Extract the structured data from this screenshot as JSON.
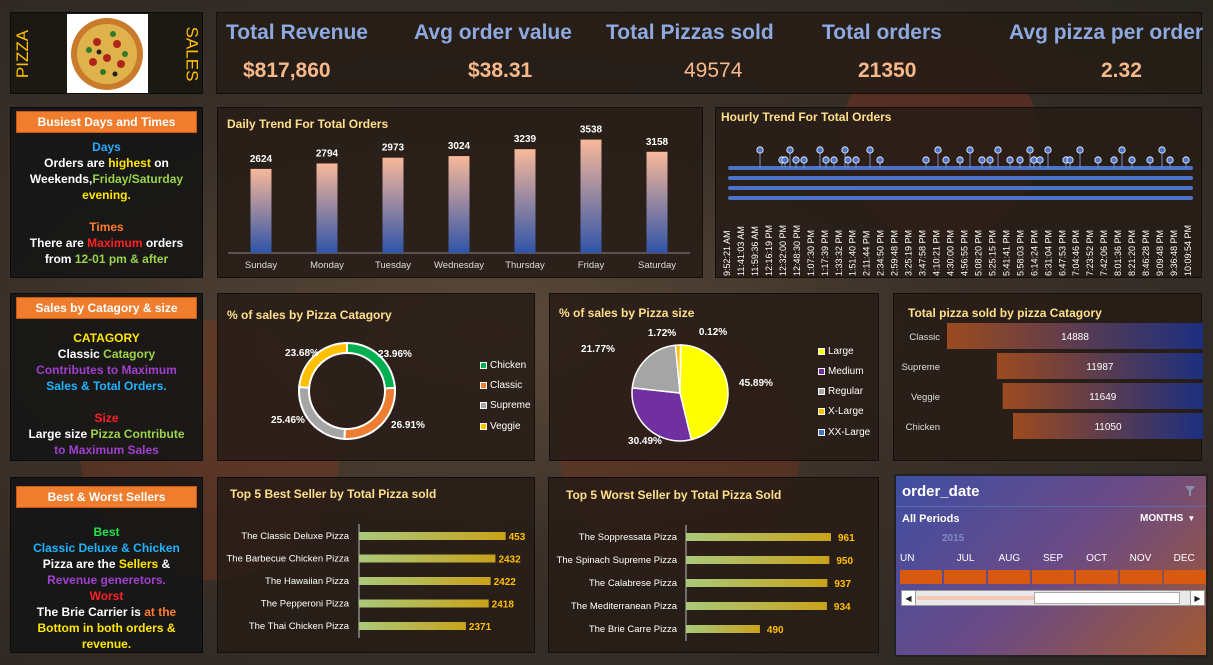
{
  "logo": {
    "left_text": "PIZZA",
    "right_text": "SALES"
  },
  "kpis": [
    {
      "title": "Total Revenue",
      "value": "$817,860"
    },
    {
      "title": "Avg order value",
      "value": "$38.31"
    },
    {
      "title": "Total Pizzas sold",
      "value": "49574"
    },
    {
      "title": "Total orders",
      "value": "21350"
    },
    {
      "title": "Avg pizza per order",
      "value": "2.32"
    }
  ],
  "side": {
    "busiest": {
      "header": "Busiest Days and Times",
      "days_label": "Days",
      "line1_a": "Orders are ",
      "line1_b": "highest",
      "line1_c": " on",
      "line2_a": "Weekends,",
      "line2_b": "Friday/Saturday",
      "line3": "evening.",
      "times_label": "Times",
      "line4_a": "There are ",
      "line4_b": "Maximum",
      "line4_c": " orders",
      "line5_a": "from  ",
      "line5_b": "12-01 pm & after"
    },
    "category": {
      "header": "Sales by Catagory & size",
      "cat_label": "CATAGORY",
      "line1_a": "Classic ",
      "line1_b": "Catagory",
      "line2": "Contributes to Maximum",
      "line3": "Sales & Total Orders.",
      "size_label": "Size",
      "line4_a": "Large size ",
      "line4_b": "Pizza Contribute",
      "line5": "to Maximum Sales"
    },
    "sellers": {
      "header": "Best & Worst  Sellers",
      "best_label": "Best",
      "line1": "Classic Deluxe & Chicken",
      "line2_a": "Pizza are the ",
      "line2_b": "Sellers",
      "line2_c": "  &",
      "line3": "Revenue generetors.",
      "worst_label": "Worst",
      "line4_a": "The Brie Carrier is ",
      "line4_b": "at the",
      "line5": "Bottom in both orders &",
      "line6": "revenue."
    }
  },
  "colors": {
    "chicken": "#00b050",
    "classic": "#ed7d31",
    "supreme": "#a5a5a5",
    "veggie": "#ffc000",
    "large": "#ffff00",
    "medium": "#7030a0",
    "regular": "#a5a5a5",
    "xlarge": "#ffc000",
    "xxlarge": "#4472c4"
  },
  "chart_data": [
    {
      "id": "daily",
      "type": "bar",
      "title": "Daily Trend For Total Orders",
      "categories": [
        "Sunday",
        "Monday",
        "Tuesday",
        "Wednesday",
        "Thursday",
        "Friday",
        "Saturday"
      ],
      "values": [
        2624,
        2794,
        2973,
        3024,
        3239,
        3538,
        3158
      ],
      "ylim": [
        0,
        3900
      ]
    },
    {
      "id": "hourly",
      "type": "scatter",
      "title": "Hourly Trend For  Total Orders",
      "x_tick_labels": [
        "9:52:21 AM",
        "11:41:03 AM",
        "11:59:36 AM",
        "12:16:19 PM",
        "12:32:00 PM",
        "12:48:30 PM",
        "1:07:30 PM",
        "1:17:39 PM",
        "1:33:32 PM",
        "1:51:40 PM",
        "2:11:44 PM",
        "2:34:50 PM",
        "2:59:48 PM",
        "3:25:19 PM",
        "3:47:58 PM",
        "4:10:21 PM",
        "4:30:00 PM",
        "4:56:55 PM",
        "5:08:20 PM",
        "5:25:15 PM",
        "5:41:41 PM",
        "5:58:03 PM",
        "6:14:24 PM",
        "6:31:04 PM",
        "6:47:53 PM",
        "7:04:46 PM",
        "7:23:52 PM",
        "7:42:06 PM",
        "8:01:36 PM",
        "8:21:20 PM",
        "8:46:28 PM",
        "9:09:48 PM",
        "9:36:48 PM",
        "10:09:54 PM"
      ],
      "ylim": [
        0,
        4
      ]
    },
    {
      "id": "category_pct",
      "type": "pie",
      "title": "% of sales by Pizza Catagory",
      "labels": [
        "Chicken",
        "Classic",
        "Supreme",
        "Veggie"
      ],
      "values": [
        23.96,
        26.91,
        25.46,
        23.68
      ],
      "value_labels": [
        "23.96%",
        "26.91%",
        "25.46%",
        "23.68%"
      ]
    },
    {
      "id": "size_pct",
      "type": "pie",
      "title": "% of sales by Pizza size",
      "labels": [
        "Large",
        "Medium",
        "Regular",
        "X-Large",
        "XX-Large"
      ],
      "values": [
        45.89,
        30.49,
        21.77,
        1.72,
        0.12
      ],
      "value_labels": [
        "45.89%",
        "30.49%",
        "21.77%",
        "1.72%",
        "0.12%"
      ]
    },
    {
      "id": "category_total",
      "type": "bar",
      "title": "Total pizza sold by pizza Catagory",
      "categories": [
        "Classic",
        "Supreme",
        "Veggie",
        "Chicken"
      ],
      "values": [
        14888,
        11987,
        11649,
        11050
      ],
      "value_labels": [
        "14888",
        "11987",
        "11649",
        "11050"
      ]
    },
    {
      "id": "top5",
      "type": "bar",
      "title": "Top 5 Best Seller by Total Pizza sold",
      "categories": [
        "The Classic Deluxe Pizza",
        "The Barbecue Chicken Pizza",
        "The Hawaiian Pizza",
        "The Pepperoni Pizza",
        "The Thai Chicken Pizza"
      ],
      "values": [
        2453,
        2432,
        2422,
        2418,
        2371
      ],
      "value_labels": [
        "453",
        "2432",
        "2422",
        "2418",
        "2371"
      ]
    },
    {
      "id": "bottom5",
      "type": "bar",
      "title": "Top 5 Worst Seller by Total Pizza Sold",
      "categories": [
        "The Soppressata Pizza",
        "The Spinach Supreme Pizza",
        "The Calabrese Pizza",
        "The Mediterranean Pizza",
        "The Brie Carre Pizza"
      ],
      "values": [
        961,
        950,
        937,
        934,
        490
      ],
      "value_labels": [
        "961",
        "950",
        "937",
        "934",
        "490"
      ]
    }
  ],
  "slicer": {
    "title": "order_date",
    "all_periods": "All Periods",
    "level": "MONTHS",
    "year": "2015",
    "months": [
      "UN",
      "JUL",
      "AUG",
      "SEP",
      "OCT",
      "NOV",
      "DEC"
    ]
  }
}
